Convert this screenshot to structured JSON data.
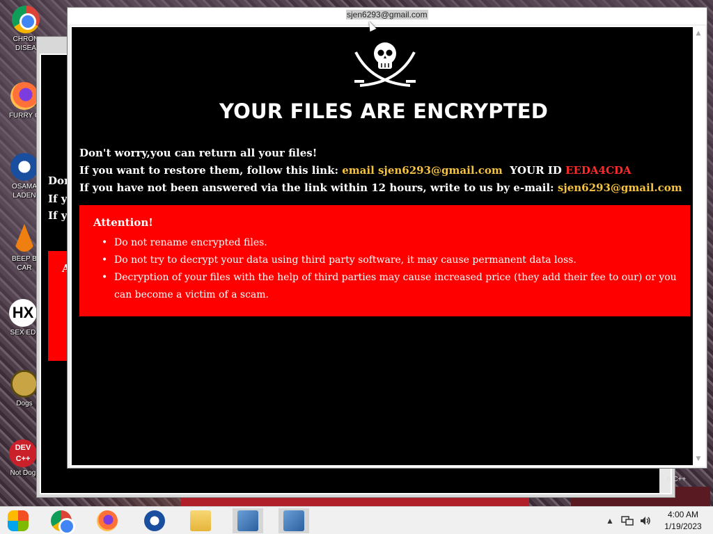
{
  "desktop": {
    "icons": [
      {
        "label": "CHRON\nDISEA",
        "icon": "chrome-icon"
      },
      {
        "label": "FURRY C",
        "icon": "firefox-icon"
      },
      {
        "label": "OSAMA\nLADEN",
        "icon": "obama-icon"
      },
      {
        "label": "BEEP B\nCAR",
        "icon": "vlc-cone-icon"
      },
      {
        "label": "SEX ED",
        "icon": "hx-icon"
      },
      {
        "label": "Dogs",
        "icon": "dog-icon"
      },
      {
        "label": "Not Dog",
        "icon": "devcpp-icon"
      }
    ],
    "dev_icon_text": "DEV\nC++"
  },
  "back_window": {
    "lines": [
      "Don",
      "If yo",
      "If yo"
    ],
    "red_letter": "A",
    "status_fragment": "n C++"
  },
  "window": {
    "title": "sjen6293@gmail.com",
    "headline": "YOUR FILES ARE ENCRYPTED",
    "line1": "Don't worry,you can return all your files!",
    "line2_prefix": "If you want to restore them, follow this link:",
    "line2_email": "email sjen6293@gmail.com",
    "line2_id_label": "YOUR ID",
    "line2_id": "EEDA4CDA",
    "line3_prefix": "If you have not been answered via the link within 12 hours, write to us by e-mail:",
    "line3_email": "sjen6293@gmail.com",
    "attention": {
      "title": "Attention!",
      "items": [
        "Do not rename encrypted files.",
        "Do not try to decrypt your data using third party software, it may cause permanent data loss.",
        "Decryption of your files with the help of third parties may cause increased price (they add their fee to our) or you can become a victim of a scam."
      ]
    },
    "colors": {
      "background": "#000000",
      "attention_box": "#ff0000",
      "highlight_yellow": "#f5c242",
      "id_red": "#ff2a2a"
    }
  },
  "taskbar": {
    "apps": [
      "start-icon",
      "chrome-icon",
      "firefox-icon",
      "obama-icon",
      "file-explorer-icon",
      "setup-icon",
      "setup-icon"
    ],
    "time": "4:00 AM",
    "date": "1/19/2023"
  }
}
